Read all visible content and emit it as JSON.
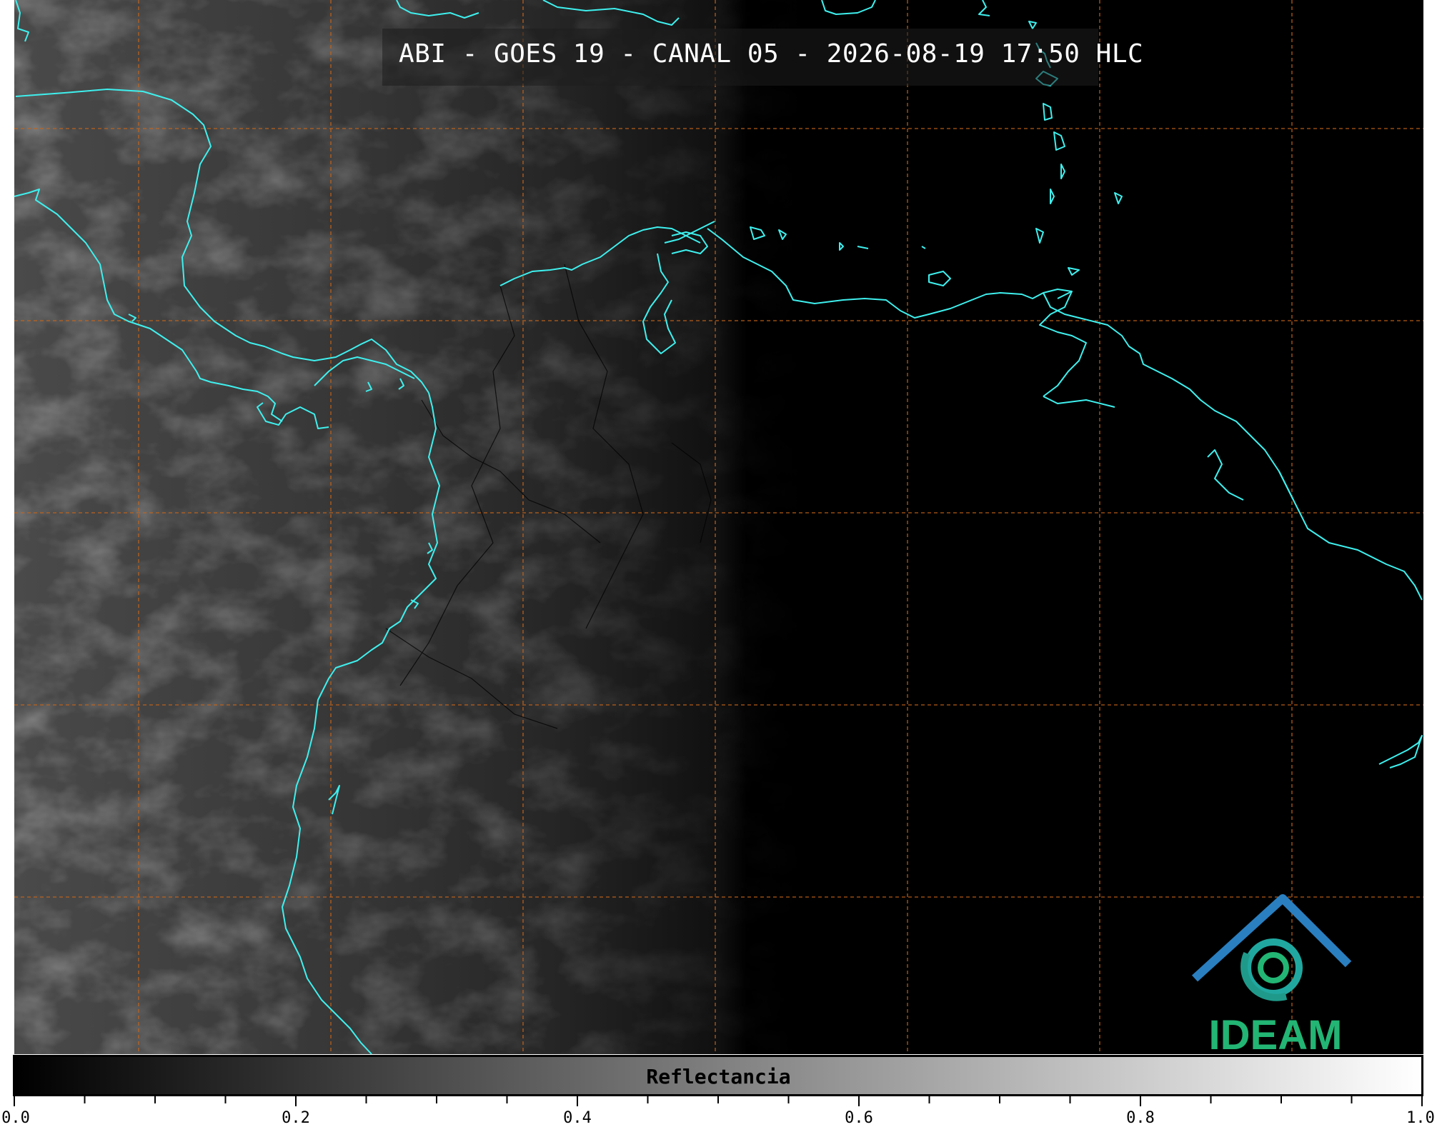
{
  "title": "ABI - GOES 19 - CANAL 05 - 2026-08-19 17:50 HLC",
  "colorbar": {
    "label": "Reflectancia",
    "ticks": [
      "0.0",
      "0.2",
      "0.4",
      "0.6",
      "0.8",
      "1.0"
    ],
    "gradient_start": "#000000",
    "gradient_end": "#ffffff"
  },
  "logo": {
    "text": "IDEAM",
    "color": "#22b574",
    "accent": "#2a7fc0"
  },
  "colors": {
    "coastline": "#3ef0ee",
    "grid": "#c8651a",
    "background": "#000000",
    "borders": "#000000"
  },
  "map_style": {
    "grid_lines": true,
    "grid_style": "dashed"
  }
}
